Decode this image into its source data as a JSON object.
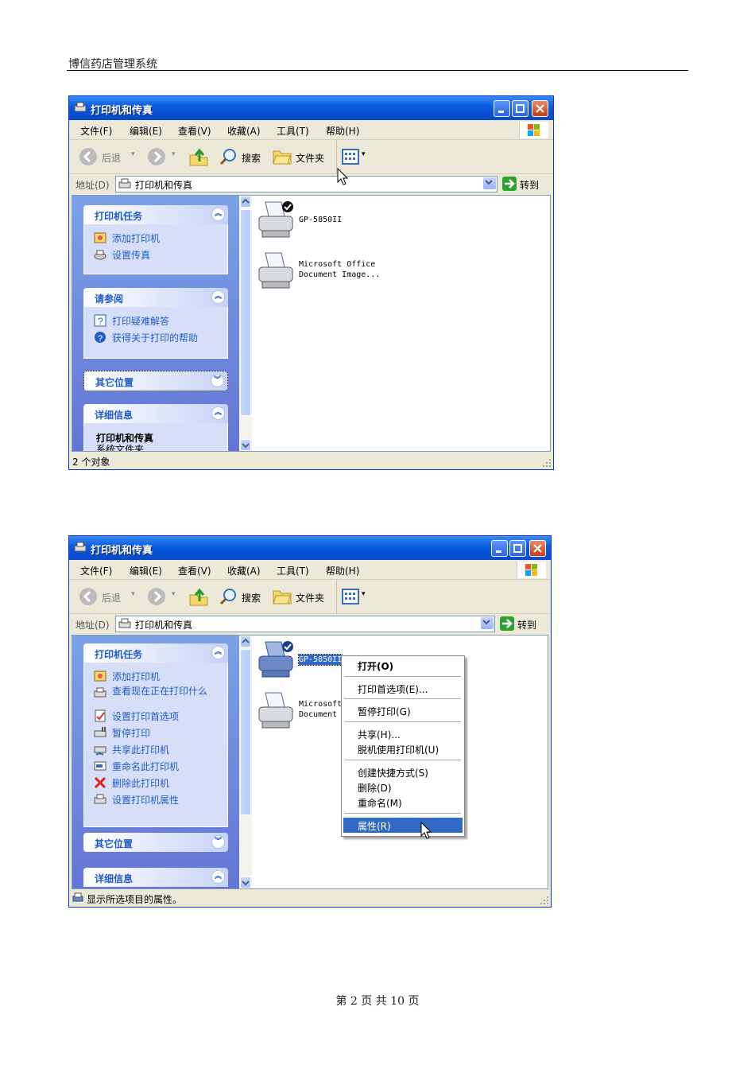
{
  "header": {
    "title": "博信药店管理系统"
  },
  "footer": {
    "page_text": "第 2 页 共 10 页"
  },
  "screenshot1": {
    "title": "打印机和传真",
    "menu": [
      "文件(F)",
      "编辑(E)",
      "查看(V)",
      "收藏(A)",
      "工具(T)",
      "帮助(H)"
    ],
    "toolbar": {
      "back": "后退",
      "search": "搜索",
      "folders": "文件夹"
    },
    "address": {
      "label": "地址(D)",
      "value": "打印机和传真",
      "go": "转到"
    },
    "panels": {
      "tasks": {
        "title": "打印机任务",
        "items": [
          "添加打印机",
          "设置传真"
        ]
      },
      "see_also": {
        "title": "请参阅",
        "items": [
          "打印疑难解答",
          "获得关于打印的帮助"
        ]
      },
      "other": {
        "title": "其它位置"
      },
      "details": {
        "title": "详细信息",
        "name": "打印机和传真",
        "sub": "系统文件夹"
      }
    },
    "files": [
      {
        "name": "GP-5850II"
      },
      {
        "name": "Microsoft Office\nDocument Image..."
      }
    ],
    "status": "2 个对象"
  },
  "screenshot2": {
    "title": "打印机和传真",
    "menu": [
      "文件(F)",
      "编辑(E)",
      "查看(V)",
      "收藏(A)",
      "工具(T)",
      "帮助(H)"
    ],
    "toolbar": {
      "back": "后退",
      "search": "搜索",
      "folders": "文件夹"
    },
    "address": {
      "label": "地址(D)",
      "value": "打印机和传真",
      "go": "转到"
    },
    "panels": {
      "tasks": {
        "title": "打印机任务",
        "items": [
          "添加打印机",
          "查看现在正在打印什么",
          "设置打印首选项",
          "暂停打印",
          "共享此打印机",
          "重命名此打印机",
          "删除此打印机",
          "设置打印机属性"
        ]
      },
      "other": {
        "title": "其它位置"
      },
      "details": {
        "title": "详细信息"
      }
    },
    "files": [
      {
        "name": "GP-5850II"
      },
      {
        "name": "Microsoft\nDocument"
      }
    ],
    "context_menu": [
      "打开(O)",
      "打印首选项(E)...",
      "暂停打印(G)",
      "共享(H)...",
      "脱机使用打印机(U)",
      "创建快捷方式(S)",
      "删除(D)",
      "重命名(M)",
      "属性(R)"
    ],
    "status": "显示所选项目的属性。"
  }
}
